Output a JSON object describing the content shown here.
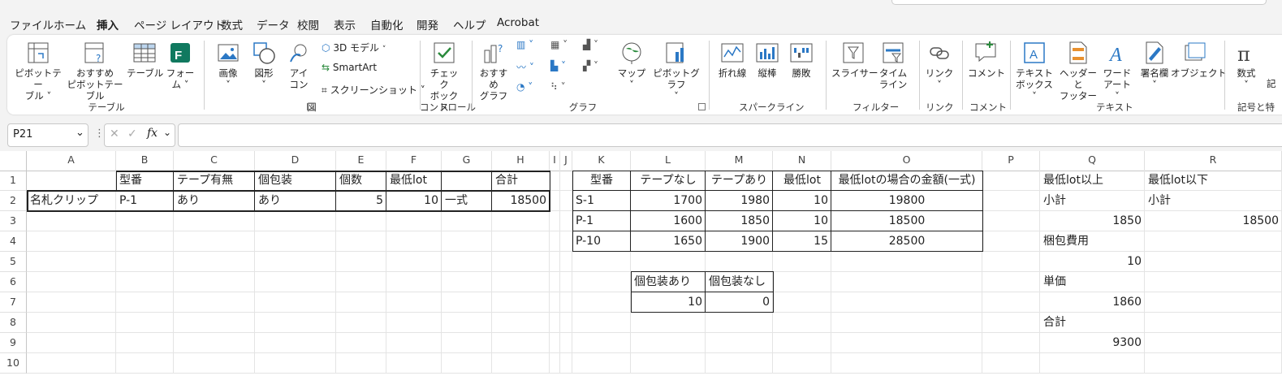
{
  "menu": [
    "ファイル",
    "ホーム",
    "挿入",
    "ページ レイアウト",
    "数式",
    "データ",
    "校閲",
    "表示",
    "自動化",
    "開発",
    "ヘルプ",
    "Acrobat"
  ],
  "ribbon": {
    "pivot_table": "ピボットテー\nブル ˅",
    "recommended_pivot": "おすすめ\nピボットテーブル",
    "table": "テーブル",
    "forms": "フォー\nム ˅",
    "image": "画像\n˅",
    "shapes": "図形\n˅",
    "icons": "アイ\nコン",
    "model3d": "3D モデル",
    "smartart": "SmartArt",
    "screenshot": "スクリーンショット ˅",
    "checkbox": "チェック\nボックス",
    "recommended_charts": "おすすめ\nグラフ",
    "maps": "マップ\n˅",
    "pivot_chart": "ピボットグラフ\n˅",
    "sparkline_line": "折れ線",
    "sparkline_column": "縦棒",
    "sparkline_winloss": "勝敗",
    "slicer": "スライサー",
    "timeline": "タイム\nライン",
    "link": "リンク\n˅",
    "comment": "コメント",
    "textbox": "テキスト\nボックス ˅",
    "header_footer": "ヘッダーと\nフッター",
    "wordart": "ワード\nアート ˅",
    "signature": "署名欄\n˅",
    "object": "オブジェクト",
    "equation": "数式\n˅",
    "symbol": "記"
  },
  "groups": {
    "tables": "テーブル",
    "illustrations": "図",
    "controls": "コントロール",
    "charts": "グラフ",
    "sparklines": "スパークライン",
    "filters": "フィルター",
    "links": "リンク",
    "comments": "コメント",
    "text": "テキスト",
    "symbols": "記号と特"
  },
  "formula_bar": {
    "name_box": "P21",
    "formula": ""
  },
  "columns": [
    "A",
    "B",
    "C",
    "D",
    "E",
    "F",
    "G",
    "H",
    "I",
    "J",
    "K",
    "L",
    "M",
    "N",
    "O",
    "P",
    "Q",
    "R"
  ],
  "rows": [
    "1",
    "2",
    "3",
    "4",
    "5",
    "6",
    "7",
    "8",
    "9",
    "10"
  ],
  "cells": {
    "B1": "型番",
    "C1": "テープ有無",
    "D1": "個包装",
    "E1": "個数",
    "F1": "最低lot",
    "H1": "合計",
    "A2": "名札クリップ",
    "B2": "P-1",
    "C2": "あり",
    "D2": "あり",
    "E2": "5",
    "F2": "10",
    "G2": "一式",
    "H2": "18500",
    "K1": "型番",
    "L1": "テープなし",
    "M1": "テープあり",
    "N1": "最低lot",
    "O1": "最低lotの場合の金額(一式)",
    "K2": "S-1",
    "L2": "1700",
    "M2": "1980",
    "N2": "10",
    "O2": "19800",
    "K3": "P-1",
    "L3": "1600",
    "M3": "1850",
    "N3": "10",
    "O3": "18500",
    "K4": "P-10",
    "L4": "1650",
    "M4": "1900",
    "N4": "15",
    "O4": "28500",
    "L6": "個包装あり",
    "M6": "個包装なし",
    "L7": "10",
    "M7": "0",
    "Q1": "最低lot以上",
    "R1": "最低lot以下",
    "Q2": "小計",
    "R2": "小計",
    "Q3": "1850",
    "R3": "18500",
    "Q4": "梱包費用",
    "Q5": "10",
    "Q6": "単価",
    "Q7": "1860",
    "Q8": "合計",
    "Q9": "9300"
  }
}
